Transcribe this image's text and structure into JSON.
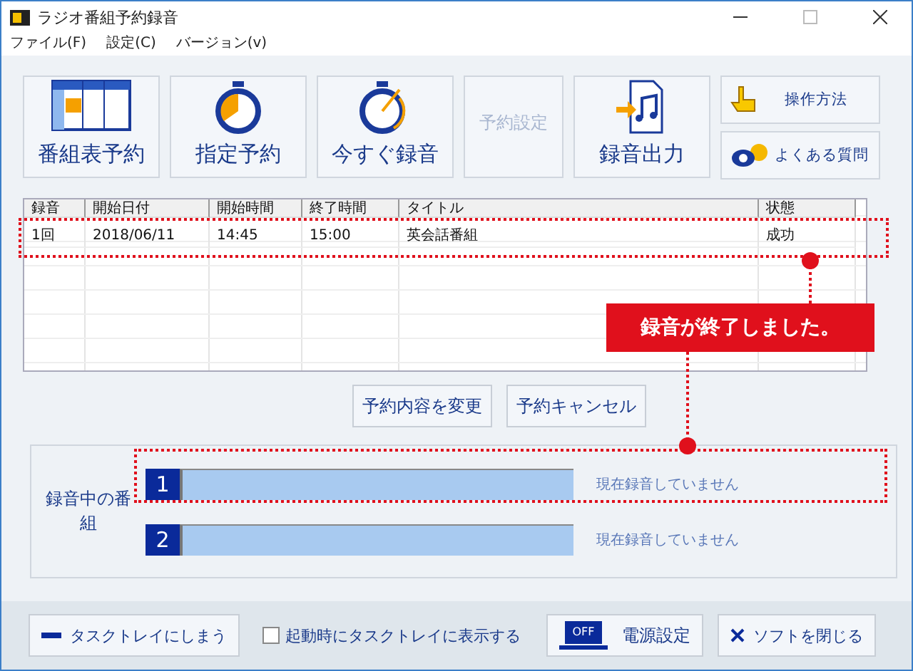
{
  "window": {
    "title": "ラジオ番組予約録音"
  },
  "menu": [
    "ファイル(F)",
    "設定(C)",
    "バージョン(v)"
  ],
  "toolbar": [
    {
      "kind": "schedule",
      "label": "番組表予約",
      "disabled": false
    },
    {
      "kind": "timer",
      "label": "指定予約",
      "disabled": false
    },
    {
      "kind": "record",
      "label": "今すぐ録音",
      "disabled": false
    },
    {
      "kind": "plain",
      "label": "予約設定",
      "disabled": true
    },
    {
      "kind": "export",
      "label": "録音出力",
      "disabled": false
    }
  ],
  "help_buttons": [
    {
      "kind": "hand",
      "label": "操作方法"
    },
    {
      "kind": "qa",
      "label": "よくある質問"
    }
  ],
  "table": {
    "columns": [
      "録音",
      "開始日付",
      "開始時間",
      "終了時間",
      "タイトル",
      "状態"
    ],
    "rows": [
      [
        "1回",
        "2018/06/11",
        "14:45",
        "15:00",
        "英会話番組",
        "成功"
      ]
    ]
  },
  "actions": [
    "予約内容を変更",
    "予約キャンセル"
  ],
  "recording": {
    "label": "録音中の番組",
    "slots": [
      {
        "number": "1",
        "status": "現在録音していません"
      },
      {
        "number": "2",
        "status": "現在録音していません"
      }
    ]
  },
  "callout": "録音が終了しました。",
  "bottom": {
    "tray_button": "タスクトレイにしまう",
    "startup_checkbox": {
      "label": "起動時にタスクトレイに表示する",
      "checked": false
    },
    "power_button": {
      "icon_text": "OFF",
      "label": "電源設定"
    },
    "close_button": "ソフトを閉じる"
  }
}
